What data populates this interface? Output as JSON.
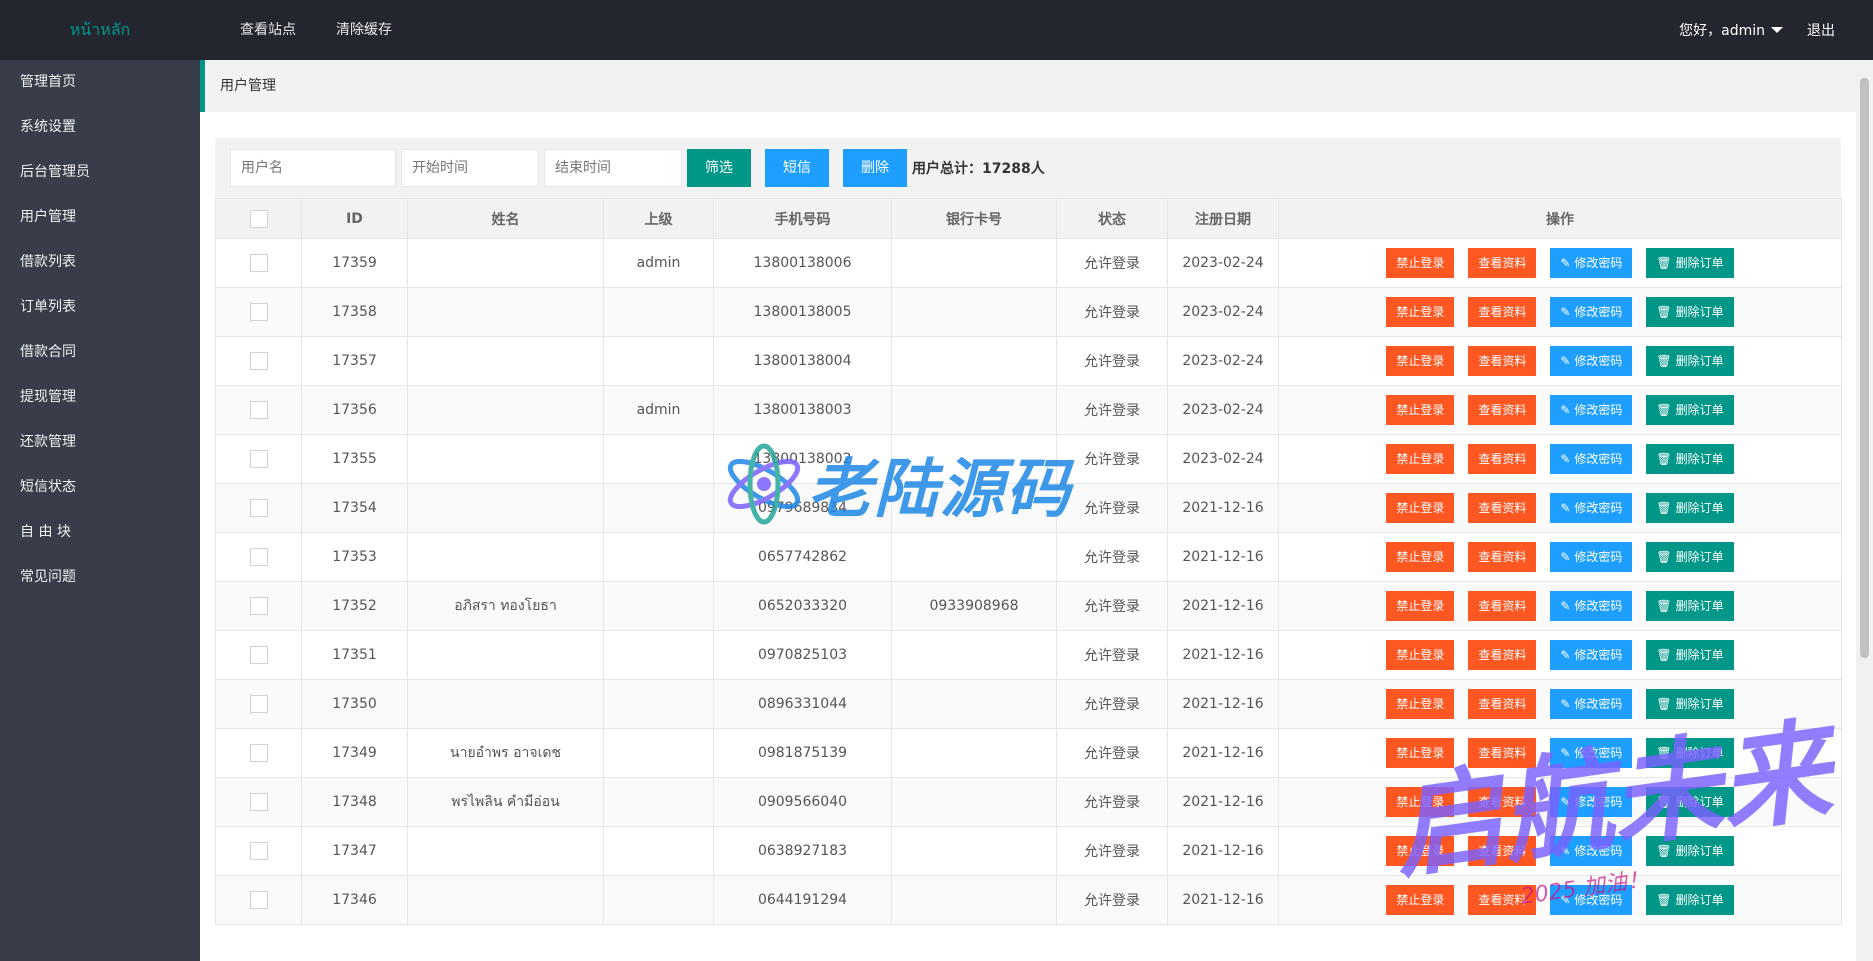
{
  "header": {
    "logo": "หน้าหลัก",
    "nav": [
      "查看站点",
      "清除缓存"
    ],
    "user": "您好，admin",
    "logout": "退出"
  },
  "sidebar": {
    "items": [
      "管理首页",
      "系统设置",
      "后台管理员",
      "用户管理",
      "借款列表",
      "订单列表",
      "借款合同",
      "提现管理",
      "还款管理",
      "短信状态",
      "自 由 块",
      "常见问题"
    ]
  },
  "breadcrumb": "用户管理",
  "toolbar": {
    "username_placeholder": "用户名",
    "start_placeholder": "开始时间",
    "end_placeholder": "结束时间",
    "filter_label": "筛选",
    "sms_label": "短信",
    "delete_label": "删除",
    "total": "用户总计：17288人"
  },
  "table": {
    "headers": [
      "ID",
      "姓名",
      "上级",
      "手机号码",
      "银行卡号",
      "状态",
      "注册日期",
      "操作"
    ],
    "actions": {
      "ban": "禁止登录",
      "view": "查看资料",
      "pwd": "修改密码",
      "del": "删除订单"
    },
    "rows": [
      {
        "id": "17359",
        "name": "",
        "parent": "admin",
        "phone": "13800138006",
        "card": "",
        "status": "允许登录",
        "date": "2023-02-24"
      },
      {
        "id": "17358",
        "name": "",
        "parent": "",
        "phone": "13800138005",
        "card": "",
        "status": "允许登录",
        "date": "2023-02-24"
      },
      {
        "id": "17357",
        "name": "",
        "parent": "",
        "phone": "13800138004",
        "card": "",
        "status": "允许登录",
        "date": "2023-02-24"
      },
      {
        "id": "17356",
        "name": "",
        "parent": "admin",
        "phone": "13800138003",
        "card": "",
        "status": "允许登录",
        "date": "2023-02-24"
      },
      {
        "id": "17355",
        "name": "",
        "parent": "",
        "phone": "13800138002",
        "card": "",
        "status": "允许登录",
        "date": "2023-02-24"
      },
      {
        "id": "17354",
        "name": "",
        "parent": "",
        "phone": "0979689834",
        "card": "",
        "status": "允许登录",
        "date": "2021-12-16"
      },
      {
        "id": "17353",
        "name": "",
        "parent": "",
        "phone": "0657742862",
        "card": "",
        "status": "允许登录",
        "date": "2021-12-16"
      },
      {
        "id": "17352",
        "name": "อภิสรา ทองโยธา",
        "parent": "",
        "phone": "0652033320",
        "card": "0933908968",
        "status": "允许登录",
        "date": "2021-12-16"
      },
      {
        "id": "17351",
        "name": "",
        "parent": "",
        "phone": "0970825103",
        "card": "",
        "status": "允许登录",
        "date": "2021-12-16"
      },
      {
        "id": "17350",
        "name": "",
        "parent": "",
        "phone": "0896331044",
        "card": "",
        "status": "允许登录",
        "date": "2021-12-16"
      },
      {
        "id": "17349",
        "name": "นายอำพร อาจเดช",
        "parent": "",
        "phone": "0981875139",
        "card": "",
        "status": "允许登录",
        "date": "2021-12-16"
      },
      {
        "id": "17348",
        "name": "พรไพลิน คำมีอ่อน",
        "parent": "",
        "phone": "0909566040",
        "card": "",
        "status": "允许登录",
        "date": "2021-12-16"
      },
      {
        "id": "17347",
        "name": "",
        "parent": "",
        "phone": "0638927183",
        "card": "",
        "status": "允许登录",
        "date": "2021-12-16"
      },
      {
        "id": "17346",
        "name": "",
        "parent": "",
        "phone": "0644191294",
        "card": "",
        "status": "允许登录",
        "date": "2021-12-16"
      }
    ]
  },
  "watermarks": {
    "wm1": "老陆源码",
    "wm2": "启航未来",
    "wm3": "2025 加油！"
  },
  "colors": {
    "accent": "#009688",
    "blue": "#1e9fff",
    "red": "#ff5722",
    "sidebar_bg": "#393d49",
    "topbar_bg": "#23262e"
  }
}
